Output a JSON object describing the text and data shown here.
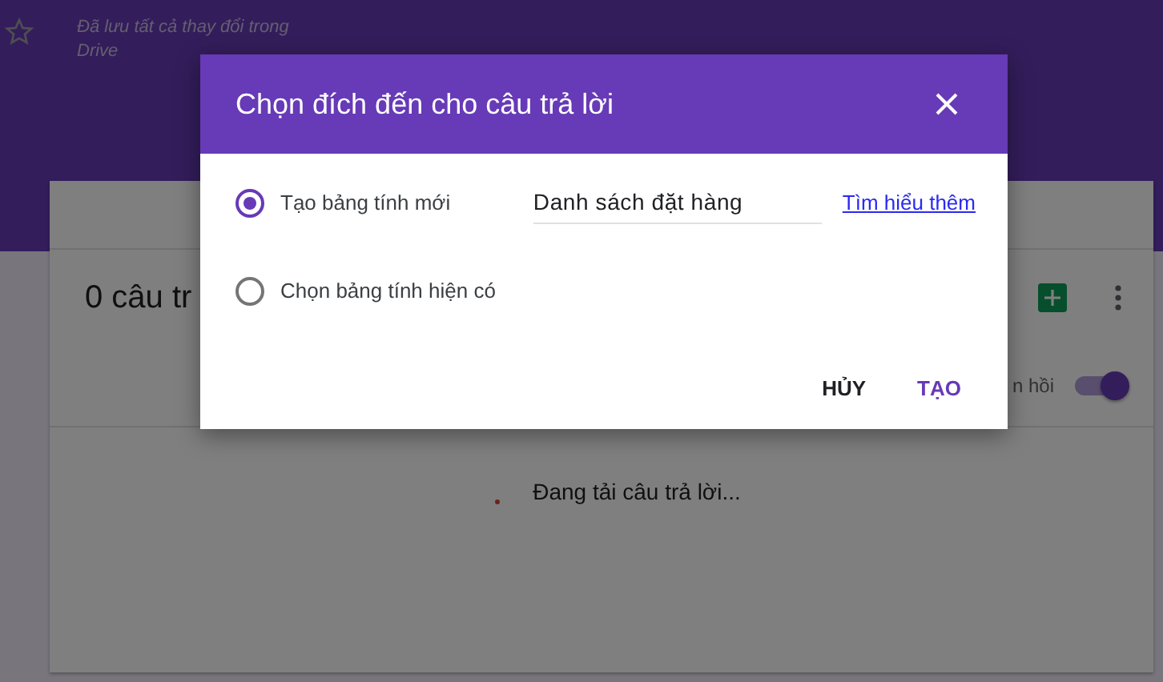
{
  "header": {
    "saved_note": "Đã lưu tất cả thay đổi trong Drive"
  },
  "card": {
    "summary": "0 câu tr",
    "setting_label": "n hồi",
    "toggle": {
      "on": true
    },
    "loading": "Đang tải câu trả lời..."
  },
  "dialog": {
    "title": "Chọn đích đến cho câu trả lời",
    "options": [
      {
        "label": "Tạo bảng tính mới",
        "selected": true,
        "field_value": "Danh sách đặt hàng",
        "link": "Tìm hiểu thêm"
      },
      {
        "label": "Chọn bảng tính hiện có",
        "selected": false
      }
    ],
    "buttons": [
      {
        "label": "HỦY",
        "kind": "cancel"
      },
      {
        "label": "TẠO",
        "kind": "primary"
      }
    ]
  }
}
